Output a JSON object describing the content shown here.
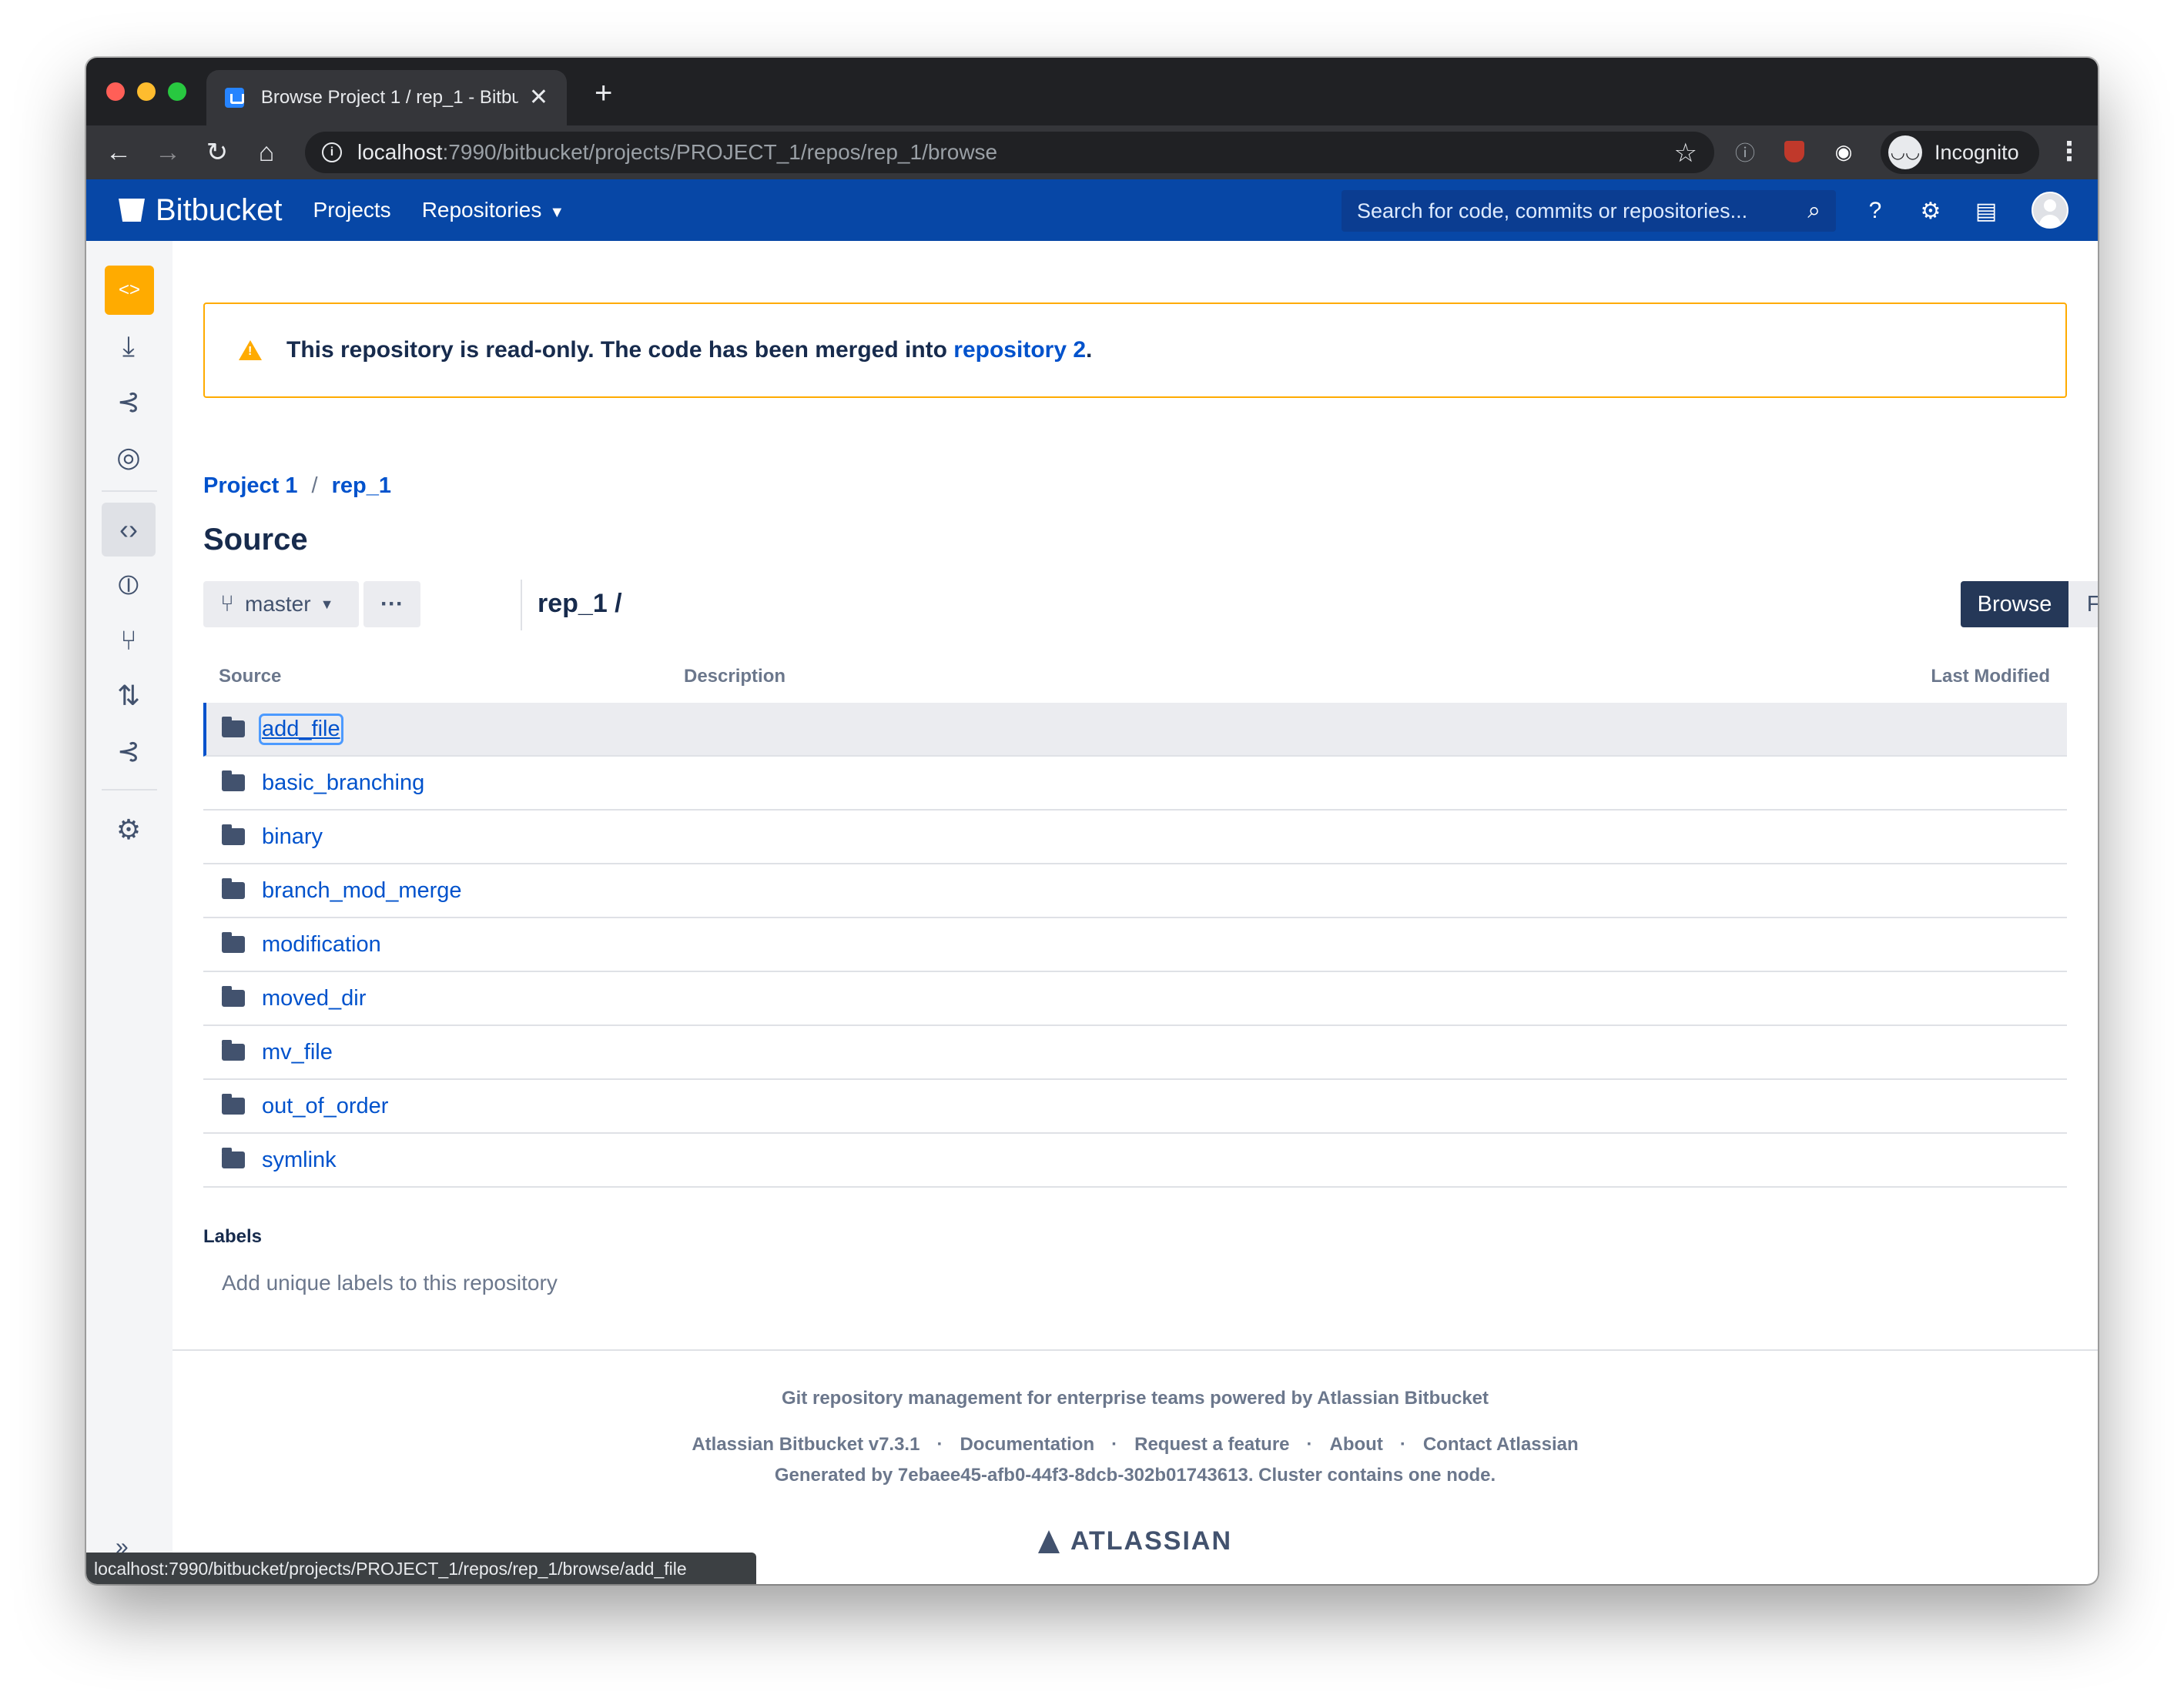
{
  "browser": {
    "tab_title": "Browse Project 1 / rep_1 - Bitbu",
    "tab_close": "✕",
    "new_tab": "+",
    "url_host": "localhost",
    "url_rest": ":7990/bitbucket/projects/PROJECT_1/repos/rep_1/browse",
    "incognito_label": "Incognito",
    "status_url": "localhost:7990/bitbucket/projects/PROJECT_1/repos/rep_1/browse/add_file"
  },
  "header": {
    "logo_text": "Bitbucket",
    "nav_projects": "Projects",
    "nav_repositories": "Repositories",
    "search_placeholder": "Search for code, commits or repositories..."
  },
  "banner": {
    "text": "This repository is read-only. The code has been merged into ",
    "link": "repository 2",
    "suffix": "."
  },
  "breadcrumb": {
    "project": "Project 1",
    "separator": "/",
    "repo": "rep_1"
  },
  "page_title": "Source",
  "toolbar": {
    "branch": "master",
    "more": "···",
    "path": "rep_1 /",
    "browse_label": "Browse",
    "filter_label": "Filter"
  },
  "table": {
    "headers": {
      "source": "Source",
      "description": "Description",
      "last_modified": "Last Modified"
    },
    "rows": [
      {
        "name": "add_file"
      },
      {
        "name": "basic_branching"
      },
      {
        "name": "binary"
      },
      {
        "name": "branch_mod_merge"
      },
      {
        "name": "modification"
      },
      {
        "name": "moved_dir"
      },
      {
        "name": "mv_file"
      },
      {
        "name": "out_of_order"
      },
      {
        "name": "symlink"
      }
    ]
  },
  "labels": {
    "title": "Labels",
    "hint": "Add unique labels to this repository"
  },
  "footer": {
    "tagline": "Git repository management for enterprise teams powered by Atlassian Bitbucket",
    "links": [
      "Atlassian Bitbucket v7.3.1",
      "Documentation",
      "Request a feature",
      "About",
      "Contact Atlassian"
    ],
    "link_separator": "·",
    "generated": "Generated by 7ebaee45-afb0-44f3-8dcb-302b01743613. Cluster contains one node.",
    "brand": "ATLASSIAN"
  },
  "colors": {
    "header_bg": "#0747a6",
    "link": "#0052cc",
    "warning": "#ffab00",
    "repo_avatar": "#ffab00"
  }
}
